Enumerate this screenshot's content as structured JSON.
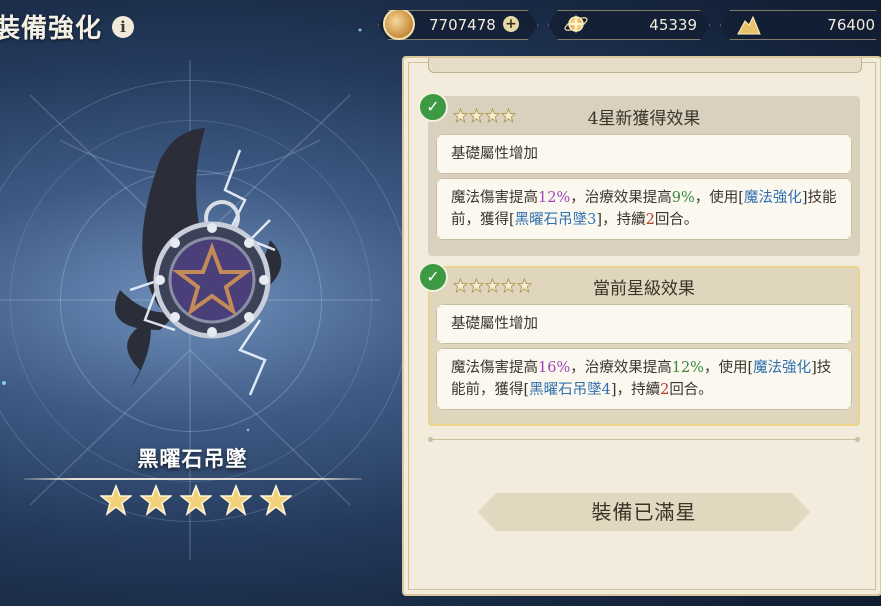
{
  "header": {
    "title": "裝備強化",
    "info_icon": "info-icon"
  },
  "currencies": [
    {
      "name": "gold",
      "icon": "gold-coin-icon",
      "value": "7707478",
      "has_add": true
    },
    {
      "name": "star",
      "icon": "star-orb-icon",
      "value": "45339"
    },
    {
      "name": "crystal",
      "icon": "crystal-pile-icon",
      "value": "76400"
    }
  ],
  "item": {
    "name": "黑曜石吊墜",
    "stars": 5,
    "max_stars": 5
  },
  "effects": [
    {
      "stars": 4,
      "title": "4星新獲得效果",
      "completed": true,
      "base_text": "基礎屬性增加",
      "desc": {
        "p1": "魔法傷害提高",
        "v1": "12%",
        "p2": "，治療效果提高",
        "v2": "9%",
        "p3": "，使用[",
        "skill": "魔法強化",
        "p4": "]技能前，獲得[",
        "buff": "黑曜石吊墜3",
        "p5": "]，持續",
        "turns": "2",
        "p6": "回合。"
      }
    },
    {
      "stars": 5,
      "title": "當前星級效果",
      "completed": true,
      "base_text": "基礎屬性增加",
      "desc": {
        "p1": "魔法傷害提高",
        "v1": "16%",
        "p2": "，治療效果提高",
        "v2": "12%",
        "p3": "，使用[",
        "skill": "魔法強化",
        "p4": "]技能前，獲得[",
        "buff": "黑曜石吊墜4",
        "p5": "]，持續",
        "turns": "2",
        "p6": "回合。"
      }
    }
  ],
  "button": {
    "maxed_label": "裝備已滿星"
  },
  "colors": {
    "purple_value": "#a048b8",
    "green_value": "#3c8a3a",
    "blue_link": "#2f6fae",
    "red_value": "#b33a2a",
    "check_green": "#3e9a42",
    "star_gold": "#f1d27a"
  }
}
